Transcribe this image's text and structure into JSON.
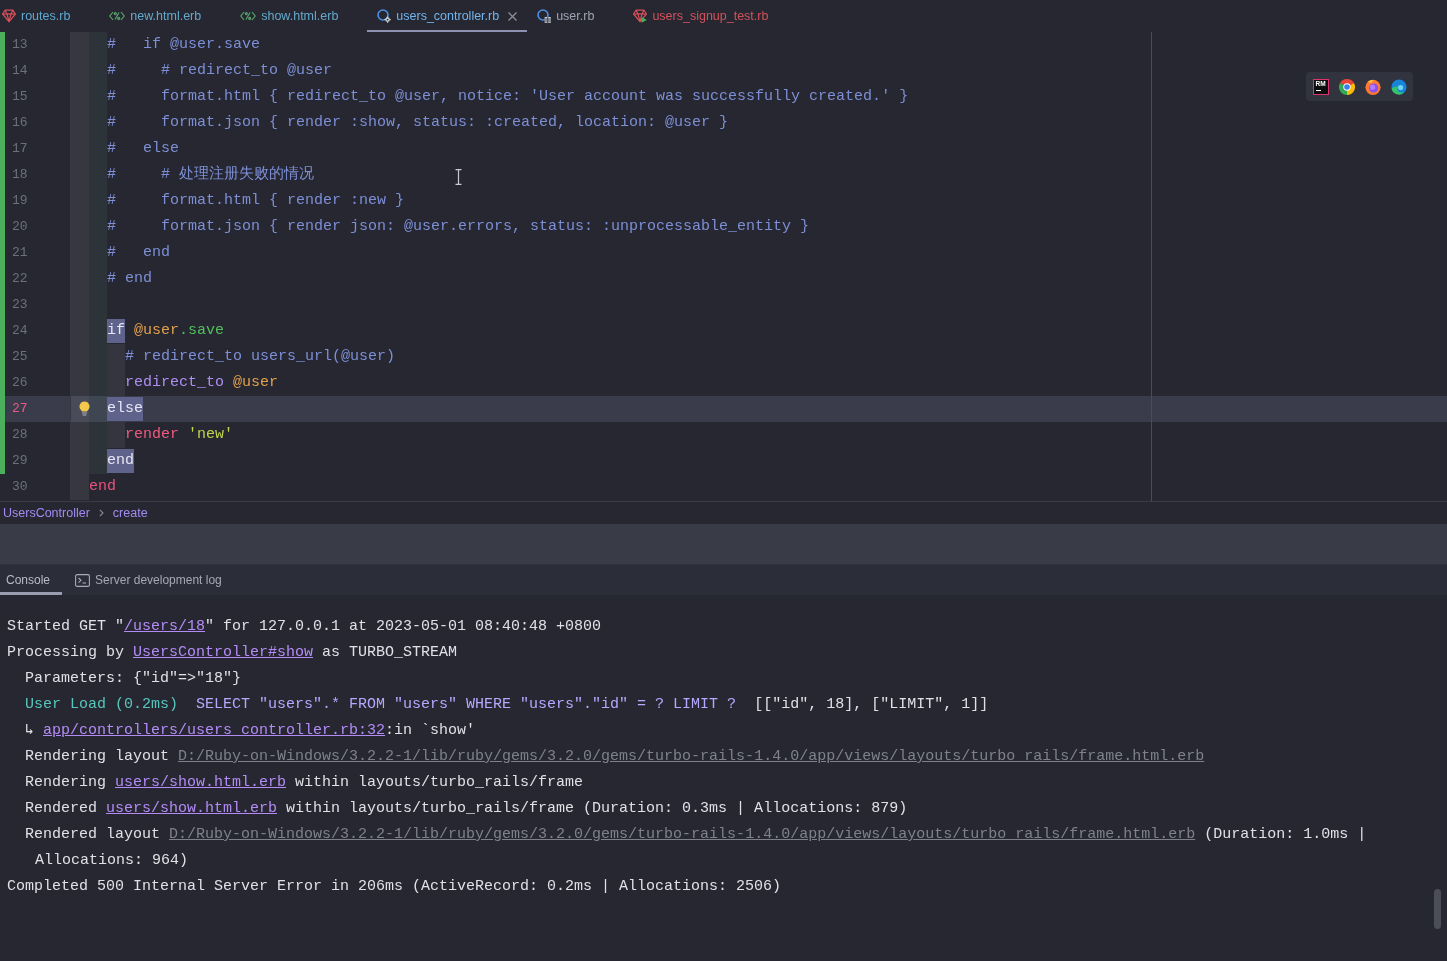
{
  "tabs": [
    {
      "label": "routes.rb",
      "kind": "ruby",
      "color": "#5fa8d3",
      "selected": false
    },
    {
      "label": "new.html.erb",
      "kind": "erb",
      "color": "#64a9cc",
      "selected": false
    },
    {
      "label": "show.html.erb",
      "kind": "erb",
      "color": "#64a9cc",
      "selected": false
    },
    {
      "label": "users_controller.rb",
      "kind": "controller",
      "color": "#72b5ef",
      "selected": true
    },
    {
      "label": "user.rb",
      "kind": "model",
      "color": "#9fa3b1",
      "selected": false
    },
    {
      "label": "users_signup_test.rb",
      "kind": "test",
      "color": "#d2525b",
      "selected": false
    }
  ],
  "editor": {
    "lines": [
      {
        "number": "13",
        "changed": true,
        "current": false,
        "tokens": [
          {
            "text": "    #   if @user.save",
            "kind": "comment"
          }
        ]
      },
      {
        "number": "14",
        "changed": true,
        "current": false,
        "tokens": [
          {
            "text": "    #     # redirect_to @user",
            "kind": "comment"
          }
        ]
      },
      {
        "number": "15",
        "changed": true,
        "current": false,
        "tokens": [
          {
            "text": "    #     format.html { redirect_to @user, notice: 'User account was successfully created.' }",
            "kind": "comment"
          }
        ]
      },
      {
        "number": "16",
        "changed": true,
        "current": false,
        "tokens": [
          {
            "text": "    #     format.json { render :show, status: :created, location: @user }",
            "kind": "comment"
          }
        ]
      },
      {
        "number": "17",
        "changed": true,
        "current": false,
        "tokens": [
          {
            "text": "    #   else",
            "kind": "comment"
          }
        ]
      },
      {
        "number": "18",
        "changed": true,
        "current": false,
        "tokens": [
          {
            "text": "    #     # 处理注册失败的情况",
            "kind": "comment"
          }
        ]
      },
      {
        "number": "19",
        "changed": true,
        "current": false,
        "tokens": [
          {
            "text": "    #     format.html { render :new }",
            "kind": "comment"
          }
        ]
      },
      {
        "number": "20",
        "changed": true,
        "current": false,
        "tokens": [
          {
            "text": "    #     format.json { render json: @user.errors, status: :unprocessable_entity }",
            "kind": "comment"
          }
        ]
      },
      {
        "number": "21",
        "changed": true,
        "current": false,
        "tokens": [
          {
            "text": "    #   end",
            "kind": "comment"
          }
        ]
      },
      {
        "number": "22",
        "changed": true,
        "current": false,
        "tokens": [
          {
            "text": "    # end",
            "kind": "comment"
          }
        ]
      },
      {
        "number": "23",
        "changed": true,
        "current": false
      },
      {
        "number": "24",
        "changed": true,
        "current": false,
        "tokens": [
          {
            "text": "    if",
            "kind": "keyword",
            "highlighted": true
          },
          {
            "text": " @user",
            "kind": "ivar"
          },
          {
            "text": ".save",
            "kind": "method"
          }
        ]
      },
      {
        "number": "25",
        "changed": true,
        "current": false,
        "tokens": [
          {
            "text": "      # redirect_to users_url(@user)",
            "kind": "comment"
          }
        ]
      },
      {
        "number": "26",
        "changed": true,
        "current": false,
        "tokens": [
          {
            "text": "      redirect_to",
            "kind": "call"
          },
          {
            "text": " @user",
            "kind": "ivar"
          }
        ]
      },
      {
        "number": "27",
        "changed": true,
        "current": true,
        "tokens": [
          {
            "text": "    else",
            "kind": "keyword",
            "highlighted": true
          }
        ]
      },
      {
        "number": "28",
        "changed": true,
        "current": false,
        "tokens": [
          {
            "text": "      render",
            "kind": "builtin"
          },
          {
            "text": " 'new'",
            "kind": "string"
          }
        ]
      },
      {
        "number": "29",
        "changed": true,
        "current": false,
        "tokens": [
          {
            "text": "    end",
            "kind": "keyword",
            "highlighted": true
          }
        ]
      },
      {
        "number": "30",
        "changed": false,
        "current": false,
        "tokens": [
          {
            "text": "  end",
            "kind": "keyword",
            "highlighted": false
          }
        ]
      }
    ]
  },
  "browser_bar": [
    {
      "kind": "app",
      "label": "RM"
    },
    {
      "kind": "chrome"
    },
    {
      "kind": "firefox"
    },
    {
      "kind": "edge"
    }
  ],
  "breadcrumb": [
    "UsersController",
    "create"
  ],
  "console_tabs": [
    {
      "label": "Console",
      "kind": "plain",
      "selected": true
    },
    {
      "label": "Server development log",
      "kind": "terminal",
      "selected": false
    }
  ],
  "console": {
    "lines": [
      {
        "tokens": [
          {
            "text": "Started GET \"",
            "kind": "text"
          },
          {
            "text": "/users/18",
            "kind": "link"
          },
          {
            "text": "\" for 127.0.0.1 at 2023-05-01 08:40:48 +0800",
            "kind": "text"
          }
        ]
      },
      {
        "tokens": [
          {
            "text": "Processing by ",
            "kind": "text"
          },
          {
            "text": "UsersController#show",
            "kind": "link"
          },
          {
            "text": " as TURBO_STREAM",
            "kind": "text"
          }
        ],
        "children": [
          {
            "tokens": [
              {
                "text": "Parameters: {\"id\"=>\"18\"}",
                "kind": "text"
              }
            ]
          },
          {
            "tokens": [
              {
                "text": "User Load (0.2ms)",
                "kind": "sql-name"
              },
              {
                "text": "  SELECT \"users\".* FROM \"users\" WHERE \"users\".\"id\" = ? LIMIT ?",
                "kind": "sql"
              },
              {
                "text": "  [[\"id\", 18], [\"LIMIT\", 1]]",
                "kind": "text"
              }
            ]
          },
          {
            "tokens": [
              {
                "text": "↳ ",
                "kind": "text"
              },
              {
                "text": "app/controllers/users_controller.rb:32",
                "kind": "link"
              },
              {
                "text": ":in `show'",
                "kind": "text"
              }
            ]
          },
          {
            "tokens": [
              {
                "text": "Rendering layout ",
                "kind": "text"
              },
              {
                "text": "D:/Ruby-on-Windows/3.2.2-1/lib/ruby/gems/3.2.0/gems/turbo-rails-1.4.0/app/views/layouts/turbo_rails/frame.html.erb",
                "kind": "path"
              }
            ]
          },
          {
            "tokens": [
              {
                "text": "Rendering ",
                "kind": "text"
              },
              {
                "text": "users/show.html.erb",
                "kind": "link"
              },
              {
                "text": " within layouts/turbo_rails/frame",
                "kind": "text"
              }
            ]
          },
          {
            "tokens": [
              {
                "text": "Rendered ",
                "kind": "text"
              },
              {
                "text": "users/show.html.erb",
                "kind": "link"
              },
              {
                "text": " within layouts/turbo_rails/frame (Duration: 0.3ms | Allocations: 879)",
                "kind": "text"
              }
            ]
          },
          {
            "tokens": [
              {
                "text": "Rendered layout ",
                "kind": "text"
              },
              {
                "text": "D:/Ruby-on-Windows/3.2.2-1/lib/ruby/gems/3.2.0/gems/turbo-rails-1.4.0/app/views/layouts/turbo_rails/frame.html.erb",
                "kind": "path"
              },
              {
                "text": " (Duration: 1.0ms | Allocations: 964)",
                "kind": "text"
              }
            ]
          }
        ]
      },
      {
        "tokens": [
          {
            "text": "Completed 500 Internal Server Error in 206ms (ActiveRecord: 0.2ms | Allocations: 2506)",
            "kind": "text"
          }
        ]
      }
    ]
  }
}
